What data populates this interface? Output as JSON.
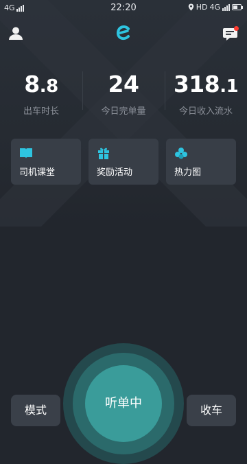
{
  "status_bar": {
    "network_left": "4G",
    "time": "22:20",
    "hd": "HD",
    "network_right": "4G"
  },
  "header": {
    "logo": "e"
  },
  "stats": [
    {
      "int": "8",
      "dec": ".8",
      "label": "出车时长"
    },
    {
      "int": "24",
      "dec": "",
      "label": "今日完单量"
    },
    {
      "int": "318",
      "dec": ".1",
      "label": "今日收入流水"
    }
  ],
  "cards": [
    {
      "label": "司机课堂",
      "icon": "book-icon"
    },
    {
      "label": "奖励活动",
      "icon": "gift-icon"
    },
    {
      "label": "热力图",
      "icon": "heatmap-icon"
    }
  ],
  "controls": {
    "mode": "模式",
    "listen": "听单中",
    "stop": "收车"
  },
  "colors": {
    "accent": "#3a9c9a",
    "icon_blue": "#2ec4e0",
    "card_bg": "#383e47",
    "background": "#22262d"
  }
}
